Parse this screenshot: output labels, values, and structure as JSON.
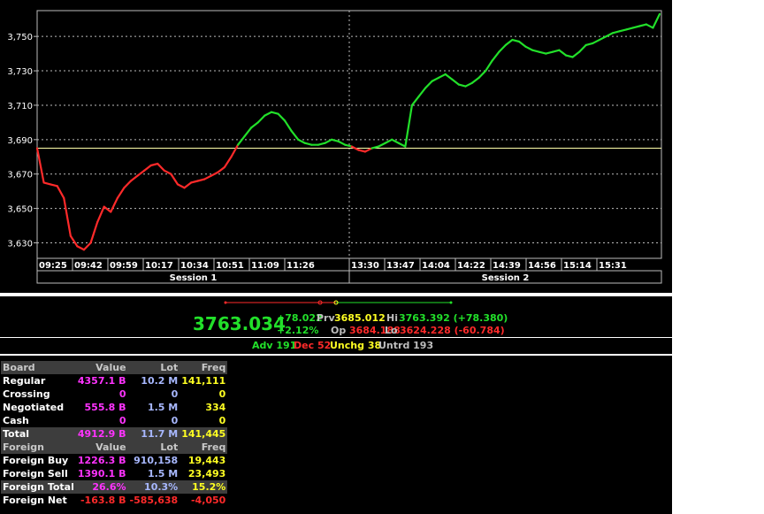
{
  "chart_data": {
    "type": "line",
    "ylim": [
      3621,
      3765
    ],
    "yticks": [
      "3,630",
      "3,650",
      "3,670",
      "3,690",
      "3,710",
      "3,730",
      "3,750"
    ],
    "ytick_values": [
      3630,
      3650,
      3670,
      3690,
      3710,
      3730,
      3750
    ],
    "xticks": [
      "09:25",
      "09:42",
      "09:59",
      "10:17",
      "10:34",
      "10:51",
      "11:09",
      "11:26",
      "13:30",
      "13:47",
      "14:04",
      "14:22",
      "14:39",
      "14:56",
      "15:14",
      "15:31"
    ],
    "sessions": [
      "Session 1",
      "Session 2"
    ],
    "reference_level": 3685.012,
    "colors": {
      "up": "#22e02a",
      "down": "#ff2a2a",
      "reference": "#ffffaa",
      "grid": "#bbbbbb",
      "axis_text": "#ffffff"
    },
    "series": [
      {
        "values": [
          3685,
          3665,
          3664,
          3663,
          3656,
          3634,
          3628,
          3626,
          3630,
          3642,
          3651,
          3648,
          3656,
          3662,
          3666,
          3669,
          3672,
          3675,
          3676,
          3672,
          3670,
          3664,
          3662,
          3665,
          3666,
          3667,
          3669,
          3671,
          3674,
          3680,
          3687,
          3692,
          3697,
          3700,
          3704,
          3706,
          3705,
          3701,
          3695,
          3690,
          3688,
          3687,
          3687,
          3688,
          3690,
          3689,
          3687,
          3686,
          3684,
          3683,
          3685,
          3686,
          3688,
          3690,
          3688,
          3686,
          3710,
          3715,
          3720,
          3724,
          3726,
          3728,
          3725,
          3722,
          3721,
          3723,
          3726,
          3730,
          3736,
          3741,
          3745,
          3748,
          3747,
          3744,
          3742,
          3741,
          3740,
          3741,
          3742,
          3739,
          3738,
          3741,
          3745,
          3746,
          3748,
          3750,
          3752,
          3753,
          3754,
          3755,
          3756,
          3757,
          3755,
          3763
        ]
      }
    ]
  },
  "summary": {
    "last": "3763.034",
    "change": "+78.022",
    "change_pct": "+2.12%",
    "prv_label": "Prv",
    "prv": "3685.012",
    "op_label": "Op",
    "op": "3684.188",
    "hi_label": "Hi",
    "hi": "3763.392 (+78.380)",
    "lo_label": "Lo",
    "lo": "3624.228 (-60.784)"
  },
  "breadth": {
    "adv": "Adv 191",
    "dec": "Dec 52",
    "unchg": "Unchg 38",
    "untrd": "Untrd 193"
  },
  "market_table": {
    "colors": {
      "value": "#ff33ff",
      "lot": "#a8b8ff",
      "freq": "#ffff22",
      "net": "#ff2a2a"
    },
    "rows": [
      {
        "kind": "hdr",
        "cells": [
          "Board",
          "Value",
          "Lot",
          "Freq"
        ]
      },
      {
        "kind": "row",
        "cells": [
          "Regular",
          "4357.1 B",
          "10.2 M",
          "141,111"
        ]
      },
      {
        "kind": "row",
        "cells": [
          "Crossing",
          "0",
          "0",
          "0"
        ]
      },
      {
        "kind": "row",
        "cells": [
          "Negotiated",
          "555.8 B",
          "1.5 M",
          "334"
        ]
      },
      {
        "kind": "row",
        "cells": [
          "Cash",
          "0",
          "0",
          "0"
        ]
      },
      {
        "kind": "tot",
        "cells": [
          "Total",
          "4912.9 B",
          "11.7 M",
          "141,445"
        ]
      },
      {
        "kind": "hdr",
        "cells": [
          "Foreign",
          "Value",
          "Lot",
          "Freq"
        ]
      },
      {
        "kind": "row",
        "cells": [
          "Foreign Buy",
          "1226.3 B",
          "910,158",
          "19,443"
        ]
      },
      {
        "kind": "row",
        "cells": [
          "Foreign Sell",
          "1390.1 B",
          "1.5 M",
          "23,493"
        ]
      },
      {
        "kind": "tot",
        "cells": [
          "Foreign Total",
          "26.6%",
          "10.3%",
          "15.2%"
        ]
      },
      {
        "kind": "net",
        "cells": [
          "Foreign Net",
          "-163.8 B",
          "-585,638",
          "-4,050"
        ]
      }
    ]
  }
}
